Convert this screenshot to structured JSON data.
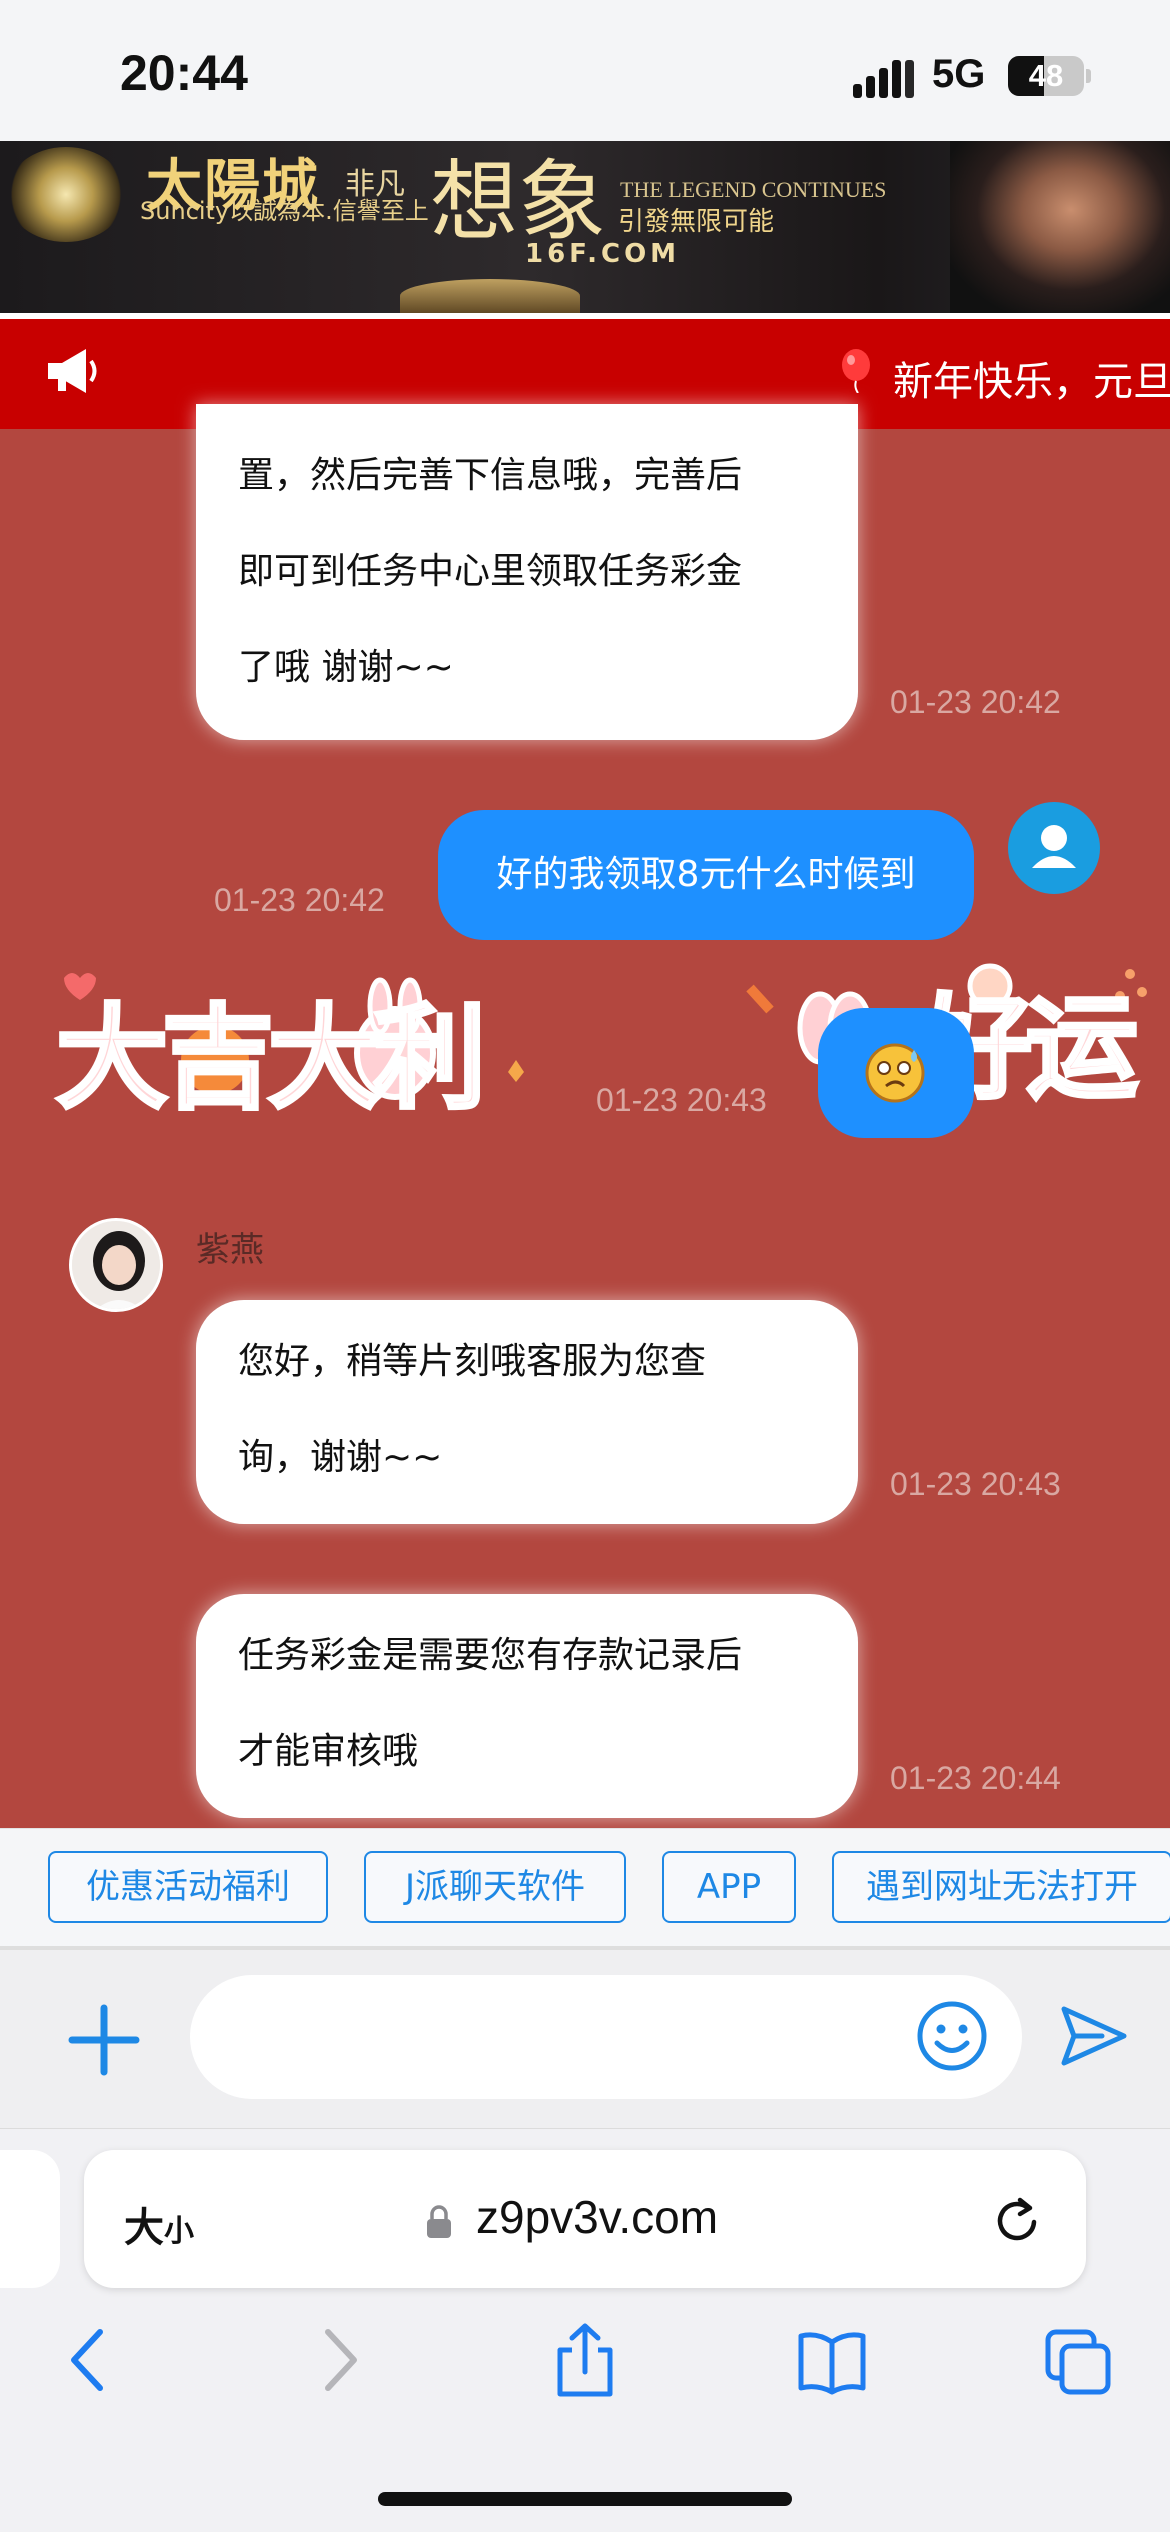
{
  "status_bar": {
    "time": "20:44",
    "network": "5G",
    "battery": "48",
    "battery_level": 0.48
  },
  "banner_ad": {
    "brand": "太陽城",
    "brand_tag": "非凡",
    "slogan": "Suncity以誠為本.信譽至上",
    "headline": "想象",
    "legend": "THE LEGEND CONTINUES",
    "tagline": "引發無限可能",
    "url": "16F.COM"
  },
  "notice": {
    "text": "新年快乐，元旦"
  },
  "messages": [
    {
      "side": "agent",
      "lines": [
        "置，然后完善下信息哦，完善后",
        "即可到任务中心里领取任务彩金",
        "了哦 谢谢~~"
      ],
      "time": "01-23 20:42"
    },
    {
      "side": "user",
      "text": "好的我领取8元什么时候到",
      "time": "01-23 20:42"
    },
    {
      "side": "user",
      "sticker": true,
      "time": "01-23 20:43"
    },
    {
      "side": "agent",
      "name": "紫燕",
      "lines": [
        "您好，稍等片刻哦客服为您查",
        "询，谢谢~~"
      ],
      "time": "01-23 20:43"
    },
    {
      "side": "agent",
      "lines": [
        "任务彩金是需要您有存款记录后",
        "才能审核哦"
      ],
      "time": "01-23 20:44"
    }
  ],
  "sticker_text": {
    "left": "大吉大利",
    "right": "好运"
  },
  "quick_buttons": [
    "优惠活动福利",
    "J派聊天软件",
    "APP",
    "遇到网址无法打开"
  ],
  "input": {
    "value": "",
    "placeholder": ""
  },
  "safari": {
    "text_size_label": "大",
    "text_size_small": "小",
    "url": "z9pv3v.com"
  },
  "colors": {
    "chat_background": "#b3473f",
    "notice_background": "#c80000",
    "user_bubble": "#1e90ff",
    "accent": "#1e88e5"
  }
}
